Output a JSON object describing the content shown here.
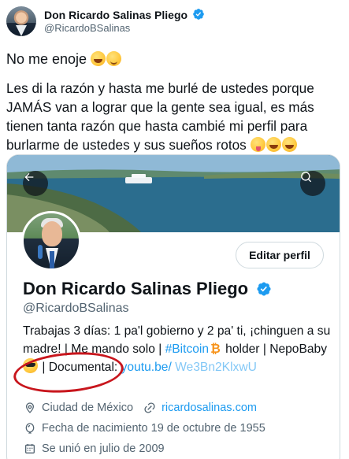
{
  "tweet": {
    "author_name": "Don Ricardo Salinas Pliego",
    "author_handle": "@RicardoBSalinas",
    "line1": "No me enoje",
    "line2": "Les di la razón y hasta me burlé de ustedes porque JAMÁS van a lograr que la gente sea igual, es más tienen tanta razón que hasta cambié mi perfil para burlarme de ustedes y sus sueños rotos"
  },
  "profile_card": {
    "edit_button_label": "Editar perfil",
    "name": "Don Ricardo Salinas Pliego",
    "handle": "@RicardoBSalinas",
    "bio": {
      "part1": "Trabajas 3 días: 1 pa'l gobierno y 2 pa' ti, ¡chinguen a su madre! | Me mando solo |",
      "hashtag": "#Bitcoin",
      "part2": "holder | NepoBaby",
      "part3": "| Documental:",
      "link": "youtu.be/",
      "link_cont": "We3Bn2KlxwU"
    },
    "location": "Ciudad de México",
    "website": "ricardosalinas.com",
    "birthday": "Fecha de nacimiento 19 de octubre de 1955",
    "joined": "Se unió en julio de 2009"
  },
  "colors": {
    "accent": "#1d9bf0",
    "verified": "#1d9bf0",
    "highlight_circle": "#c8161d",
    "secondary_text": "#536471"
  },
  "icons": [
    "verified-badge-icon",
    "back-arrow-icon",
    "search-icon",
    "location-pin-icon",
    "link-icon",
    "balloon-icon",
    "calendar-icon",
    "bitcoin-icon"
  ]
}
